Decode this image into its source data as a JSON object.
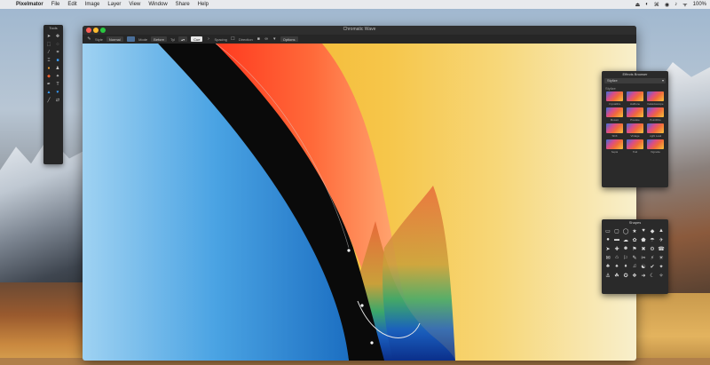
{
  "menubar": {
    "app_name": "Pixelmator",
    "items": [
      "File",
      "Edit",
      "Image",
      "Layer",
      "View",
      "Window",
      "Share",
      "Help"
    ],
    "status": [
      "⏏",
      "◐",
      "⌘",
      "◉",
      "♪",
      "ᯤ",
      "100%"
    ]
  },
  "window": {
    "title": "Chromatic Wave",
    "toolbar": {
      "items": [
        "Style",
        "Normal",
        "Mode",
        "Before",
        "Tyl",
        "Cue",
        "Spacing",
        "Direction",
        "Options"
      ]
    }
  },
  "tools_palette": {
    "title": "Tools",
    "icons": [
      "arrow-icon",
      "move-icon",
      "marquee-icon",
      "lasso-icon",
      "wand-icon",
      "crop-icon",
      "eyedropper-icon",
      "brush-icon",
      "eraser-icon",
      "stamp-icon",
      "paint-bucket-icon",
      "blur-icon",
      "pen-icon",
      "text-icon",
      "shape-icon",
      "color-wheel-icon"
    ]
  },
  "effects_browser": {
    "title": "Effects Browser",
    "category": "Stylize",
    "section": "Stylize",
    "items": [
      "Crystallize",
      "Halftone",
      "Kaleidoscope",
      "Mosaic",
      "Pixelate",
      "Pointillize",
      "Shift",
      "Vintage",
      "Light Leak",
      "Sepia",
      "Trail",
      "Vignette"
    ]
  },
  "shapes_panel": {
    "title": "Shapes",
    "glyphs": [
      "▭",
      "▢",
      "◯",
      "★",
      "♥",
      "◆",
      "▲",
      "●",
      "▬",
      "☁",
      "✿",
      "⬟",
      "☂",
      "✈",
      "➤",
      "✚",
      "☻",
      "⚑",
      "✖",
      "⚙",
      "☎",
      "✉",
      "⌂",
      "⚐",
      "✎",
      "✂",
      "⚡",
      "☀",
      "♣",
      "♠",
      "♦",
      "♫",
      "☯",
      "✔",
      "✦",
      "⚓",
      "☘",
      "✪",
      "❖",
      "➜",
      "☾",
      "✧"
    ]
  },
  "colors": {
    "close": "#ff5f57",
    "minimize": "#febc2e",
    "maximize": "#28c840",
    "panel_bg": "#2a2a2a"
  }
}
